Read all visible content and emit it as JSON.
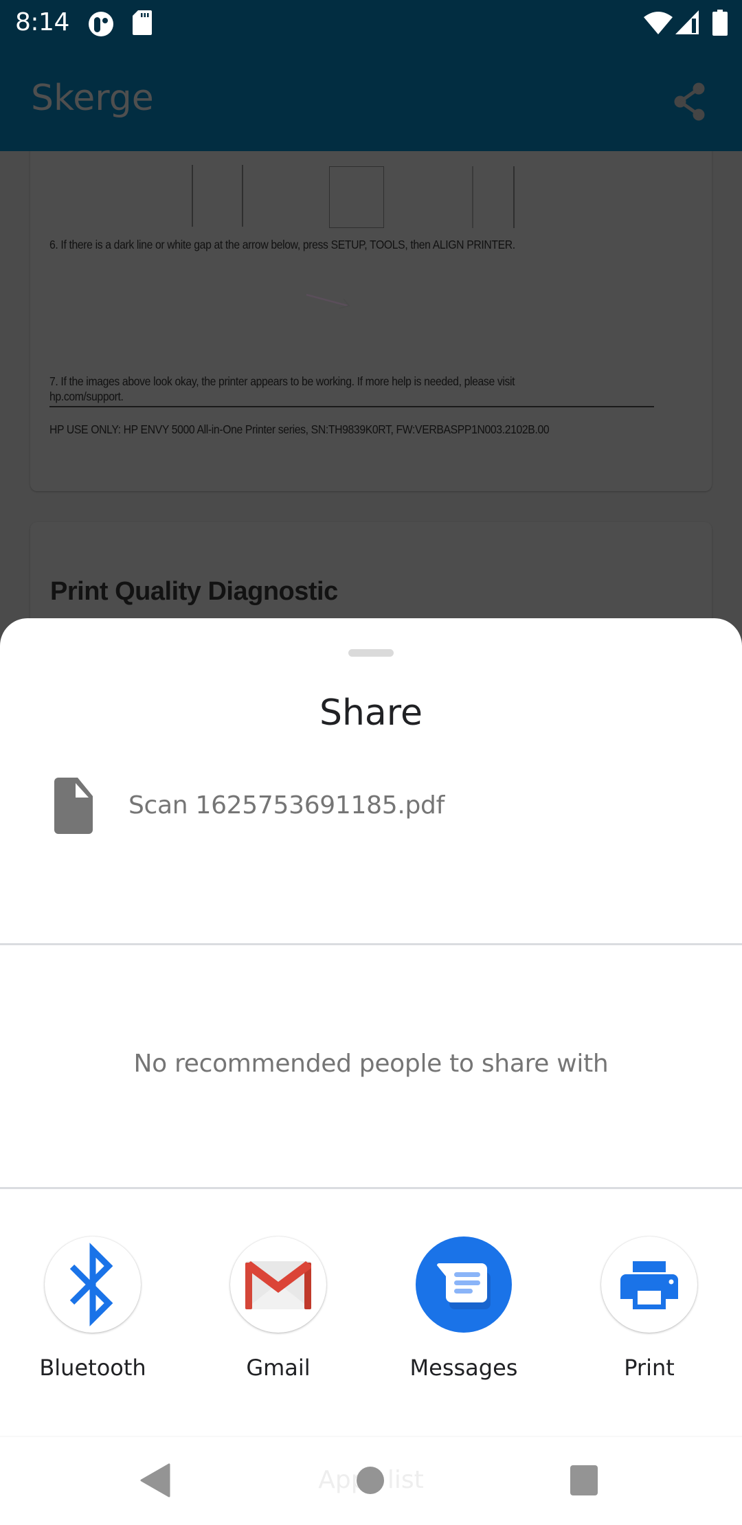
{
  "status_bar": {
    "time": "8:14",
    "left_icons": [
      "app-notification-icon",
      "sd-card-icon"
    ],
    "right_icons": [
      "wifi-icon",
      "cellular-signal-icon",
      "battery-icon"
    ],
    "background_color": "#022d41"
  },
  "app_bar": {
    "title": "Skerge",
    "action_icon": "share-icon"
  },
  "document": {
    "card1": {
      "step6": "6. If there is a dark line or white gap at the arrow below, press SETUP, TOOLS, then ALIGN PRINTER.",
      "step7_line1": "7. If the images above look okay, the printer appears to be working. If more help is needed, please visit",
      "step7_line2": "hp.com/support.",
      "hp_use_only": "HP USE ONLY: HP ENVY 5000 All-in-One Printer series, SN:TH9839K0RT, FW:VERBASPP1N003.2102B.00"
    },
    "card2": {
      "heading": "Print Quality Diagnostic"
    }
  },
  "share_sheet": {
    "title": "Share",
    "file": {
      "icon": "file-icon",
      "name": "Scan 1625753691185.pdf"
    },
    "no_recommendations": "No recommended people to share with",
    "targets": [
      {
        "label": "Bluetooth",
        "icon": "bluetooth-icon",
        "color": "#1a73e8"
      },
      {
        "label": "Gmail",
        "icon": "gmail-icon",
        "color": "#db4437"
      },
      {
        "label": "Messages",
        "icon": "messages-icon",
        "color": "#1a73e8"
      },
      {
        "label": "Print",
        "icon": "printer-icon",
        "color": "#1a73e8"
      }
    ]
  },
  "nav_bar": {
    "hint": "Apps list",
    "buttons": [
      "back",
      "home",
      "recents"
    ]
  }
}
